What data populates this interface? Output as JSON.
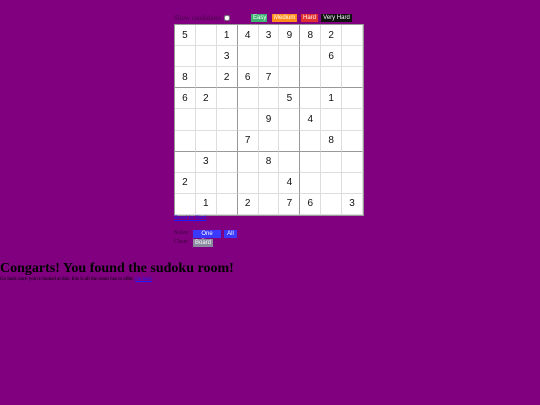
{
  "controls": {
    "show_candidates_label": "Show candidates",
    "difficulty": [
      {
        "label": "Easy",
        "color": "#3cb371"
      },
      {
        "label": "Medium",
        "color": "#ff8c1a"
      },
      {
        "label": "Hard",
        "color": "#e03030"
      },
      {
        "label": "Very Hard",
        "color": "#111111"
      }
    ]
  },
  "board": {
    "rows": [
      [
        "5",
        "",
        "1",
        "4",
        "3",
        "9",
        "8",
        "2",
        ""
      ],
      [
        "",
        "",
        "3",
        "",
        "",
        "",
        "",
        "6",
        ""
      ],
      [
        "8",
        "",
        "2",
        "6",
        "7",
        "",
        "",
        "",
        ""
      ],
      [
        "6",
        "2",
        "",
        "",
        "",
        "5",
        "",
        "1",
        ""
      ],
      [
        "",
        "",
        "",
        "",
        "9",
        "",
        "4",
        "",
        ""
      ],
      [
        "",
        "",
        "",
        "7",
        "",
        "",
        "",
        "8",
        ""
      ],
      [
        "",
        "3",
        "",
        "",
        "8",
        "",
        "",
        "",
        ""
      ],
      [
        "2",
        "",
        "",
        "",
        "",
        "4",
        "",
        "",
        ""
      ],
      [
        "",
        "1",
        "",
        "2",
        "",
        "7",
        "6",
        "",
        "3"
      ]
    ]
  },
  "reset_label": "Reset to Start",
  "solve": {
    "label": "Solve:",
    "one_step": "One Step",
    "all": "All",
    "button_color": "#3a3aff"
  },
  "clear": {
    "label": "Clear:",
    "board": "Board",
    "button_color": "#8a8aa0"
  },
  "message": {
    "title": "Congarts! You found the sudoku room!",
    "text": "Go back once you're looked at this, this is all the room has to offer.",
    "link_text": "Go back"
  }
}
